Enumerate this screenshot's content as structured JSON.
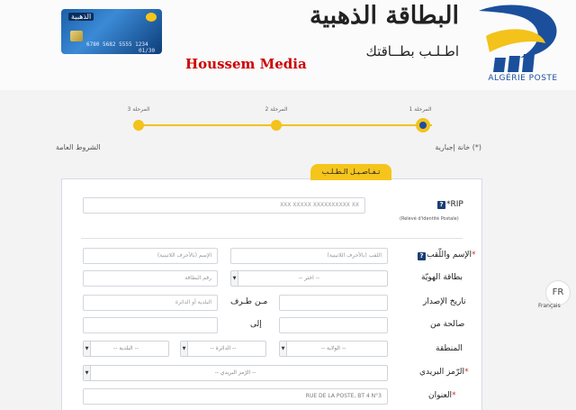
{
  "header": {
    "title": "البطاقة الذهبية",
    "subtitle": "اطـلـب بطــاقتك",
    "watermark": "Houssem Media",
    "brand": "ALGÉRIE POSTE",
    "card": {
      "label": "الذهبية",
      "number": "6780 5682 5555 1234",
      "expiry": "01/30"
    }
  },
  "steps": [
    {
      "label": "المرحلة 1",
      "active": true
    },
    {
      "label": "المرحلة 2",
      "active": false
    },
    {
      "label": "المرحلة 3",
      "active": false
    }
  ],
  "required_note": "(*) خانة إجبارية",
  "terms_link": "الشروط العامة",
  "tab_label": "تـفـاصـيـل الـطـلـب",
  "form": {
    "rip": {
      "label": "RIP*",
      "placeholder": "XXX XXXXX XXXXXXXXXX XX",
      "caption": "(Relevé d'identité Postale)"
    },
    "name": {
      "label": "الإسم واللّقب",
      "lastname_placeholder": "اللقب (بالأحرف اللاتينية)",
      "firstname_placeholder": "الإسم (بالأحرف اللاتينية)"
    },
    "id_card": {
      "label": "بطاقة الهويّة",
      "select_value": "-- اختر --",
      "number_placeholder": "رقم البطاقة"
    },
    "issue_date": {
      "label": "تاريخ الإصدار",
      "by_label": "مـن طـرف",
      "placeholder": "البلدية أو الدائرة"
    },
    "valid_until": {
      "label": "صالحة من",
      "to_label": "إلى"
    },
    "region": {
      "label": "المنطقة",
      "wilaya": "-- الولاية --",
      "daira": "-- الدائرة --",
      "commune": "-- البلدية --"
    },
    "postal_code": {
      "label": "الرّمز البريدي",
      "select_value": "-- الرّمز البريدي --"
    },
    "address": {
      "label": "العنوان",
      "value": "RUE DE LA POSTE, BT 4 N°3"
    }
  },
  "language": {
    "code": "FR",
    "label": "Français"
  },
  "colors": {
    "accent": "#f3c21b",
    "brand_blue": "#1a4fa0",
    "required": "#cc3333"
  }
}
